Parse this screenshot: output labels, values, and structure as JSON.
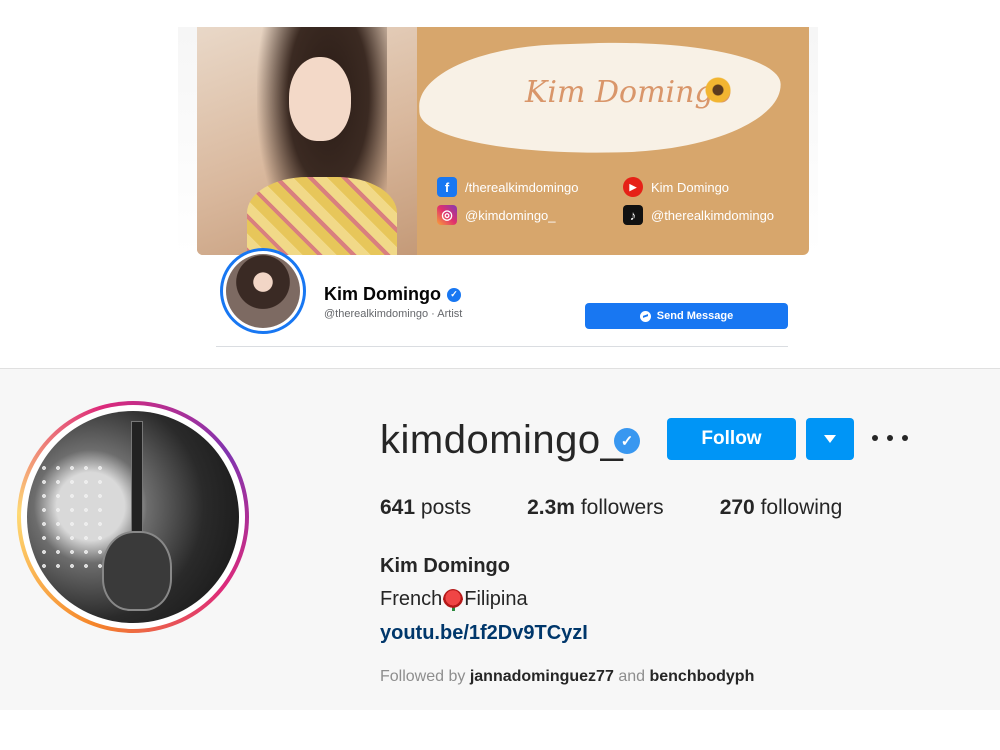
{
  "facebook": {
    "cover": {
      "brush_name": "Kim Domingo",
      "socials": {
        "facebook": "/therealkimdomingo",
        "youtube": "Kim Domingo",
        "instagram": "@kimdomingo_",
        "tiktok": "@therealkimdomingo"
      }
    },
    "page_name": "Kim Domingo",
    "page_subtitle": "@therealkimdomingo · Artist",
    "send_message_label": "Send Message",
    "accent": "#1877f2"
  },
  "instagram": {
    "username": "kimdomingo_",
    "follow_label": "Follow",
    "stats": {
      "posts_count": "641",
      "posts_label": "posts",
      "followers_count": "2.3m",
      "followers_label": "followers",
      "following_count": "270",
      "following_label": "following"
    },
    "full_name": "Kim Domingo",
    "bio_before": "French",
    "bio_after": "Filipina",
    "bio_emoji": "rose-icon",
    "link": "youtu.be/1f2Dv9TCyzI",
    "followed_by": {
      "prefix": "Followed by",
      "user1": "jannadominguez77",
      "and": "and",
      "user2": "benchbodyph"
    },
    "accent": "#0095f6"
  }
}
